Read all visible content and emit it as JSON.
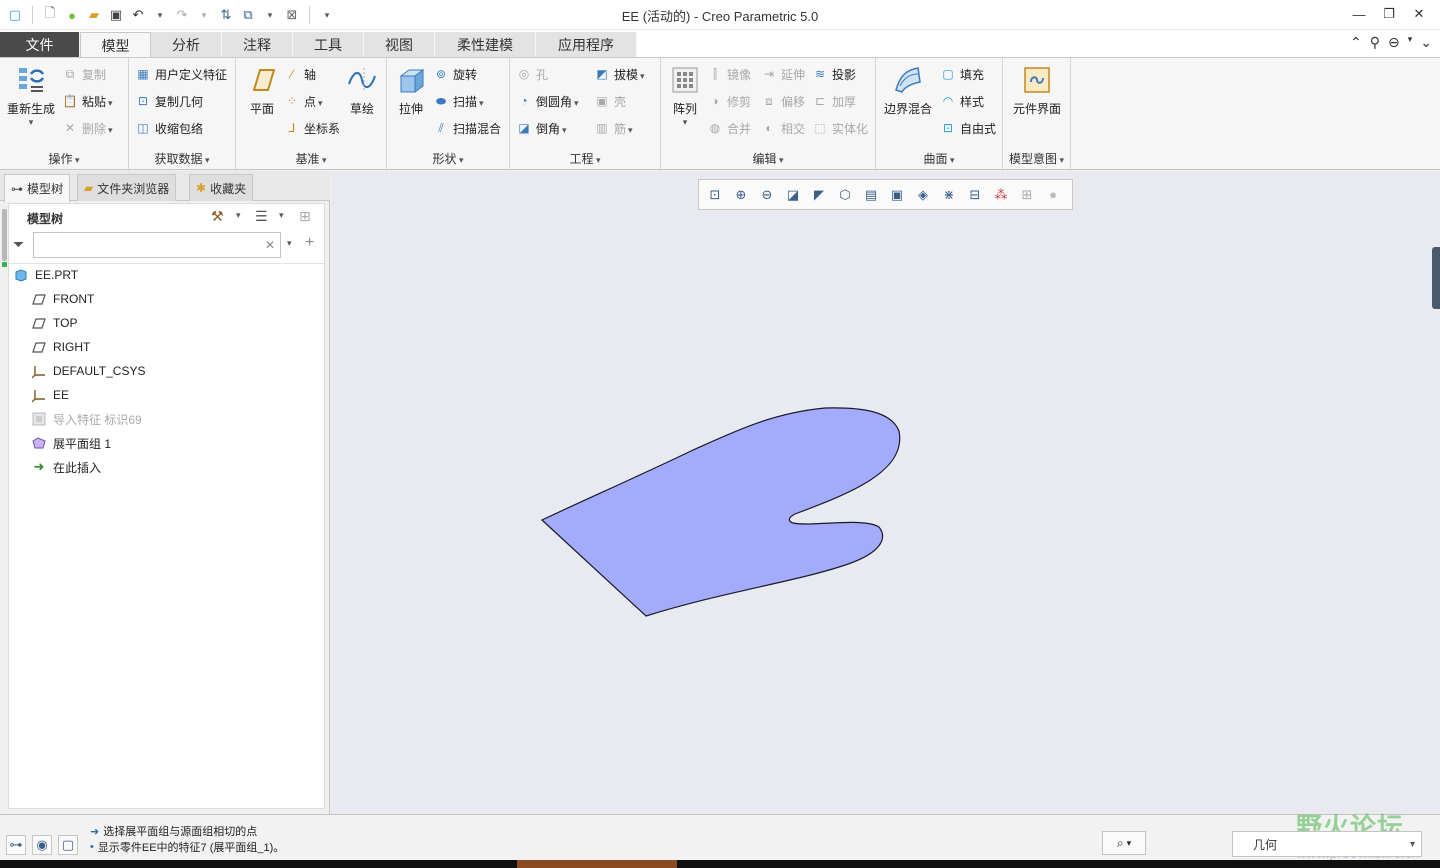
{
  "window": {
    "title": "EE (活动的) - Creo Parametric 5.0",
    "controls": [
      "minimize-icon",
      "restore-icon",
      "close-icon"
    ]
  },
  "quick_access": [
    "part-icon",
    "new-icon",
    "sphere-icon",
    "open-icon",
    "save-icon",
    "undo-icon",
    "redo-icon",
    "regenerate-icon",
    "windows-icon",
    "close-window-icon",
    "customize-icon"
  ],
  "tabs": [
    {
      "label": "文件"
    },
    {
      "label": "模型"
    },
    {
      "label": "分析"
    },
    {
      "label": "注释"
    },
    {
      "label": "工具"
    },
    {
      "label": "视图"
    },
    {
      "label": "柔性建模"
    },
    {
      "label": "应用程序"
    }
  ],
  "ribbon": {
    "operations": {
      "label": "操作",
      "regenerate": "重新生成",
      "copy": "复制",
      "paste": "粘贴",
      "delete": "删除"
    },
    "get_data": {
      "label": "获取数据",
      "udf": "用户定义特征",
      "copy_geom": "复制几何",
      "shrinkwrap": "收缩包络"
    },
    "datum": {
      "label": "基准",
      "plane": "平面",
      "axis": "轴",
      "point": "点",
      "csys": "坐标系",
      "sketch": "草绘"
    },
    "shapes": {
      "label": "形状",
      "extrude": "拉伸",
      "revolve": "旋转",
      "sweep": "扫描",
      "swept_blend": "扫描混合"
    },
    "engineering": {
      "label": "工程",
      "hole": "孔",
      "draft": "拔模",
      "round": "倒圆角",
      "shell": "壳",
      "chamfer": "倒角",
      "rib": "筋"
    },
    "editing": {
      "label": "编辑",
      "pattern": "阵列",
      "mirror": "镜像",
      "extend": "延伸",
      "project": "投影",
      "trim": "修剪",
      "offset": "偏移",
      "thicken": "加厚",
      "merge": "合并",
      "intersect": "相交",
      "solidify": "实体化"
    },
    "surfaces": {
      "label": "曲面",
      "boundary_blend": "边界混合",
      "fill": "填充",
      "style": "样式",
      "freestyle": "自由式"
    },
    "model_intent": {
      "label": "模型意图",
      "component_interface": "元件界面"
    }
  },
  "left_panel": {
    "tabs": [
      {
        "label": "模型树",
        "icon": "tree-icon"
      },
      {
        "label": "文件夹浏览器",
        "icon": "folder-icon"
      },
      {
        "label": "收藏夹",
        "icon": "favorites-icon"
      }
    ],
    "tree_title": "模型树",
    "filter_value": "",
    "items": [
      {
        "label": "EE.PRT",
        "icon": "part-icon",
        "indent": 0,
        "dim": false
      },
      {
        "label": "FRONT",
        "icon": "datum-plane-icon",
        "indent": 1,
        "dim": false
      },
      {
        "label": "TOP",
        "icon": "datum-plane-icon",
        "indent": 1,
        "dim": false
      },
      {
        "label": "RIGHT",
        "icon": "datum-plane-icon",
        "indent": 1,
        "dim": false
      },
      {
        "label": "DEFAULT_CSYS",
        "icon": "csys-icon",
        "indent": 1,
        "dim": false
      },
      {
        "label": "EE",
        "icon": "csys-icon",
        "indent": 1,
        "dim": false
      },
      {
        "label": "导入特征 标识69",
        "icon": "import-feature-icon",
        "indent": 1,
        "dim": true
      },
      {
        "label": "展平面组 1",
        "icon": "flatten-quilt-icon",
        "indent": 1,
        "dim": false
      },
      {
        "label": "在此插入",
        "icon": "insert-here-icon",
        "indent": 1,
        "dim": false
      }
    ]
  },
  "view_toolbar": [
    "refit-icon",
    "zoom-in-icon",
    "zoom-out-icon",
    "repaint-icon",
    "display-style-icon",
    "saved-orientations-icon",
    "view-manager-icon",
    "perspective-icon",
    "section-icon",
    "datum-display-icon",
    "annotation-display-icon",
    "spin-center-icon",
    "appearance-icon",
    "render-icon"
  ],
  "graphics": {
    "fill_color": "#a3acfc",
    "stroke_color": "#1a1a2a",
    "background": "#e9eaf0"
  },
  "status": {
    "messages": [
      {
        "icon": "arrow-icon",
        "text": "选择展平面组与源面组相切的点"
      },
      {
        "icon": "bullet-icon",
        "text": "显示零件EE中的特征7 (展平面组_1)。"
      }
    ],
    "filter_value": "几何",
    "watermark": "野火论坛",
    "watermark_url": "www.proewildfire.cn"
  }
}
